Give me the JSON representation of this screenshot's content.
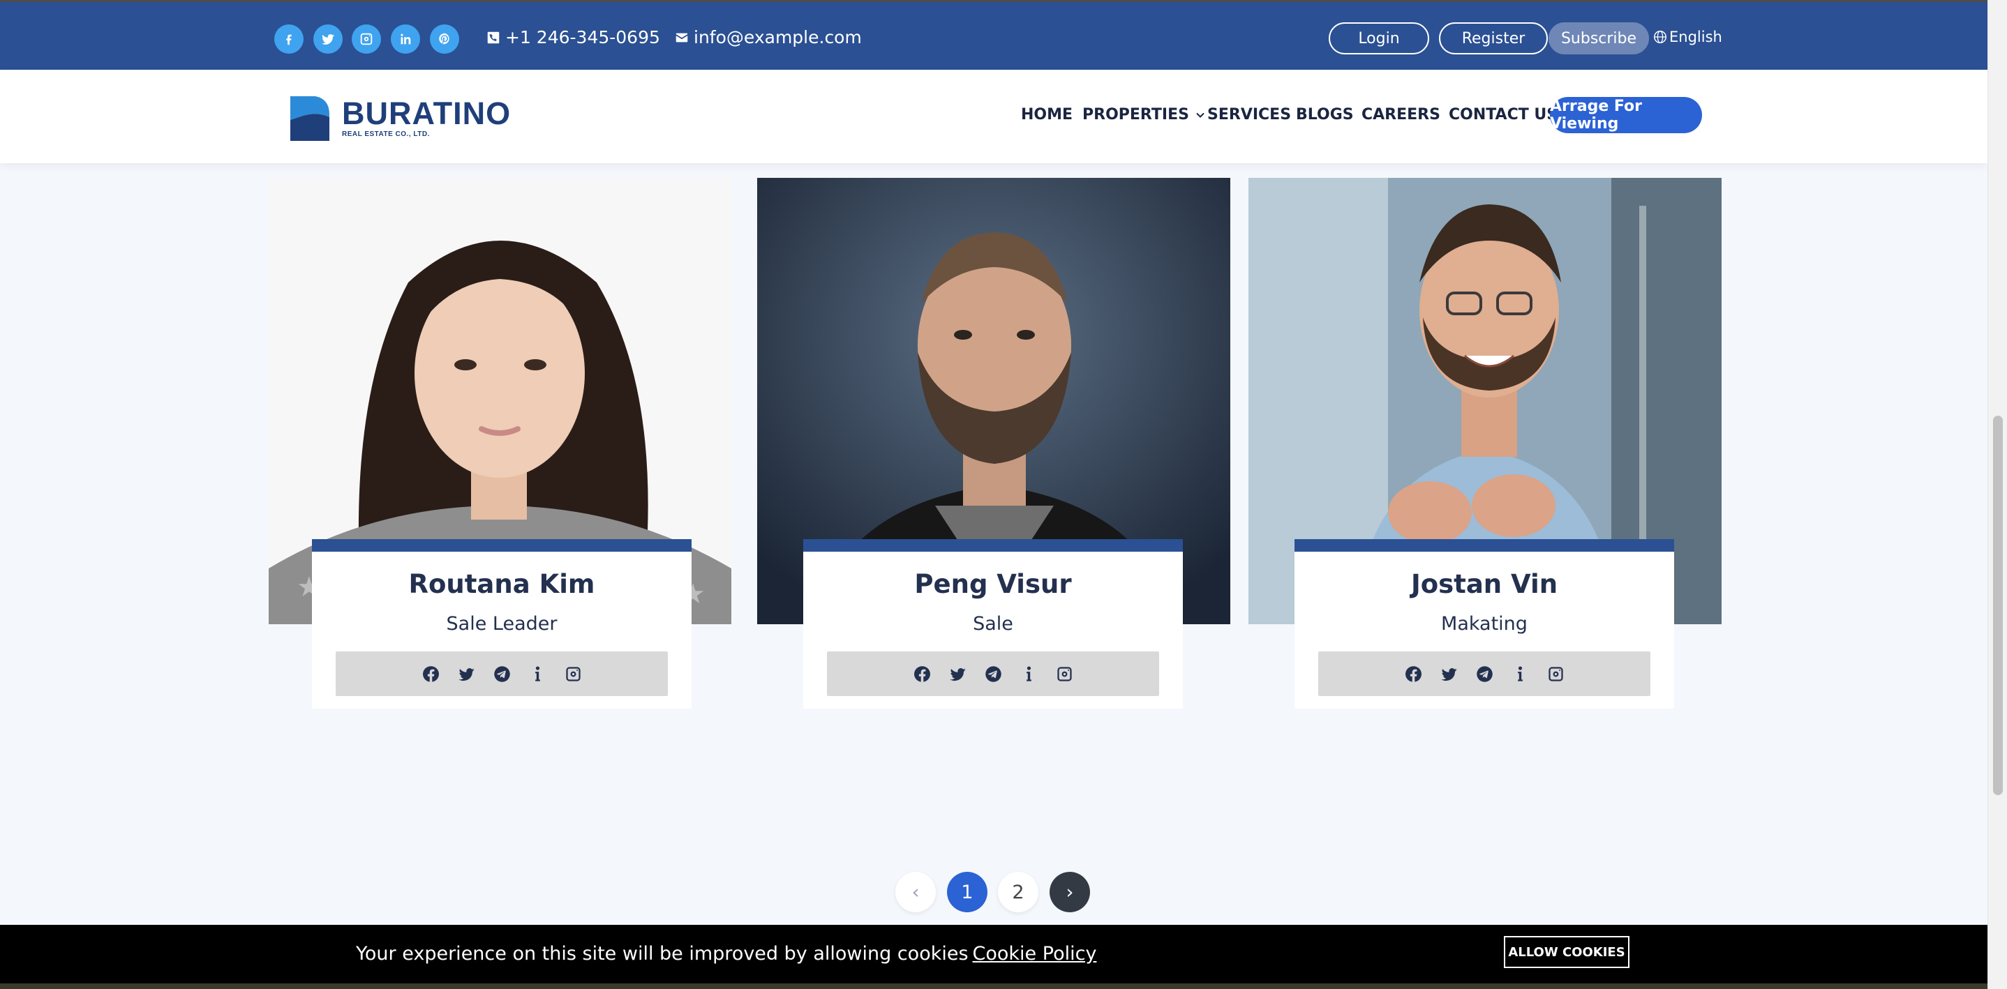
{
  "topbar": {
    "social_icons": [
      "facebook-icon",
      "twitter-icon",
      "instagram-icon",
      "linkedin-icon",
      "pinterest-icon"
    ],
    "phone": "+1 246-345-0695",
    "email": "info@example.com",
    "login_label": "Login",
    "register_label": "Register",
    "subscribe_label": "Subscribe",
    "language": "English"
  },
  "nav": {
    "logo_name": "BURATINO",
    "logo_sub": "REAL ESTATE CO., LTD.",
    "items": [
      "HOME",
      "PROPERTIES",
      "SERVICES",
      "BLOGS",
      "CAREERS",
      "CONTACT US"
    ],
    "cta_label": "Arrage For Viewing"
  },
  "team": [
    {
      "name": "Routana Kim",
      "role": "Sale Leader"
    },
    {
      "name": "Peng Visur",
      "role": "Sale"
    },
    {
      "name": "Jostan Vin",
      "role": "Makating"
    }
  ],
  "card_social_icons": [
    "facebook-icon",
    "twitter-icon",
    "telegram-icon",
    "info-icon",
    "instagram-icon"
  ],
  "pagination": {
    "prev": "‹",
    "pages": [
      "1",
      "2"
    ],
    "current": "1",
    "next": "›"
  },
  "cookie": {
    "text": "Your experience on this site will be improved by allowing cookies",
    "link": "Cookie Policy",
    "button": "ALLOW COOKIES"
  },
  "colors": {
    "brand": "#2b5093",
    "accent": "#2b62d4",
    "social": "#3fa3ef"
  }
}
